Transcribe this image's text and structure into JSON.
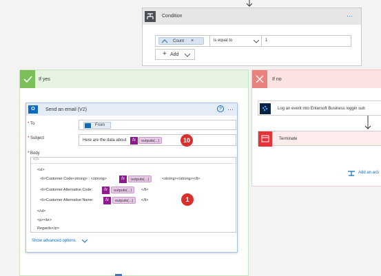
{
  "colors": {
    "yes_accent": "#7cbf58",
    "no_accent": "#e9827d",
    "outlook_blue": "#0f6cbd",
    "expression_purple": "#8e1a8e",
    "badge_red": "#d9302b",
    "terminate_red": "#e8323a",
    "condition_dark": "#484f58"
  },
  "condition": {
    "title": "Condition",
    "more": "···",
    "count_chip": "Count",
    "chip_remove": "×",
    "operator": "is equal to",
    "value": "1",
    "add_label": "Add",
    "add_plus": "+"
  },
  "branch_yes": {
    "title": "If yes",
    "email": {
      "title": "Send an email (V2)",
      "help": "?",
      "more": "···",
      "to_label": "To",
      "to_token": "From",
      "subject_label": "Subject",
      "subject_text": "Here are the data about",
      "subject_token": "outputs(...)",
      "badge_subject": "10",
      "body_label": "Body",
      "code_toggle": "</>",
      "body_lines": [
        "<ul>",
        "<li>Customer Code<strong> : </strong>",
        "<strong></strong></li>",
        "<li>Customer Alternative Code:",
        "</li>",
        "<li>Customer Alternative Name:",
        "</li>",
        "</ul>",
        "<p><br>",
        "Regards</p>"
      ],
      "fx_label": "fx",
      "token_label": "outputs(...)",
      "badge_body": "1",
      "advanced": "Show advanced options"
    }
  },
  "branch_no": {
    "title": "If no",
    "log_action": "Log an event into Entersoft Business loggin sub",
    "terminate": "Terminate",
    "add_action": "Add an acti"
  }
}
